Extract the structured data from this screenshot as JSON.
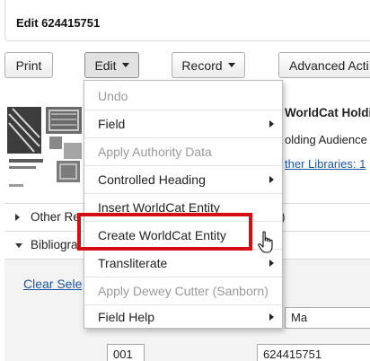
{
  "header": {
    "title": "Edit 624415751"
  },
  "toolbar": {
    "print_label": "Print",
    "edit_label": "Edit",
    "record_label": "Record",
    "advanced_label": "Advanced Acti"
  },
  "background": {
    "holdings_heading": "WorldCat Holdi",
    "holding_audience": "olding Audience",
    "other_libraries": "ther Libraries: 1",
    "other_section": "Other Re",
    "other_section_tail": ")",
    "bibliographic_section": "Bibliogra",
    "clear_selection": "Clear Sele",
    "field_value": "Ma",
    "tag_value": "001",
    "control_number": "624415751"
  },
  "edit_menu": {
    "items": [
      {
        "label": "Undo",
        "enabled": false,
        "submenu": false
      },
      {
        "label": "Field",
        "enabled": true,
        "submenu": true
      },
      {
        "label": "Apply Authority Data",
        "enabled": false,
        "submenu": false
      },
      {
        "label": "Controlled Heading",
        "enabled": true,
        "submenu": true
      },
      {
        "label": "Insert WorldCat Entity",
        "enabled": true,
        "submenu": false
      },
      {
        "label": "Create WorldCat Entity",
        "enabled": true,
        "submenu": false
      },
      {
        "label": "Transliterate",
        "enabled": true,
        "submenu": true
      },
      {
        "label": "Apply Dewey Cutter (Sanborn)",
        "enabled": false,
        "submenu": false
      },
      {
        "label": "Field Help",
        "enabled": true,
        "submenu": true
      }
    ],
    "highlighted_item": "Create WorldCat Entity"
  },
  "colors": {
    "highlight_border": "#d40d12",
    "link": "#1a55a6"
  }
}
